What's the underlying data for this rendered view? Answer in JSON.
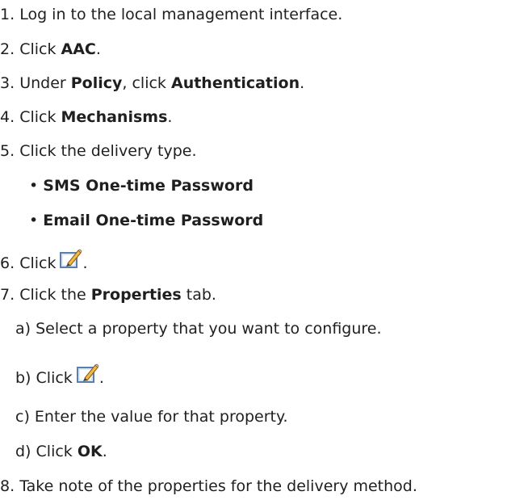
{
  "steps": [
    {
      "num": "1.",
      "text": "Log in to the local management interface."
    },
    {
      "num": "2.",
      "pre": "Click ",
      "bold": "AAC",
      "post": "."
    },
    {
      "num": "3.",
      "pre": "Under ",
      "bold": "Policy",
      "mid": ", click ",
      "bold2": "Authentication",
      "post": "."
    },
    {
      "num": "4.",
      "pre": "Click ",
      "bold": "Mechanisms",
      "post": "."
    },
    {
      "num": "5.",
      "text": "Click the delivery type."
    },
    {
      "num": "6.",
      "pre": "Click",
      "post": "."
    },
    {
      "num": "7.",
      "pre": "Click the ",
      "bold": "Properties",
      "post": " tab."
    },
    {
      "num": "8.",
      "text": "Take note of the properties for the delivery method."
    }
  ],
  "bullets": [
    {
      "marker": "•",
      "text": "SMS One-time Password"
    },
    {
      "marker": "•",
      "text": "Email One-time Password"
    }
  ],
  "substeps": [
    {
      "label": "a)",
      "text": "Select a property that you want to configure."
    },
    {
      "label": "b)",
      "pre": "Click",
      "post": "."
    },
    {
      "label": "c)",
      "text": "Enter the value for that property."
    },
    {
      "label": "d)",
      "pre": "Click ",
      "bold": "OK",
      "post": "."
    }
  ],
  "icons": {
    "edit": "edit-pencil-icon"
  }
}
